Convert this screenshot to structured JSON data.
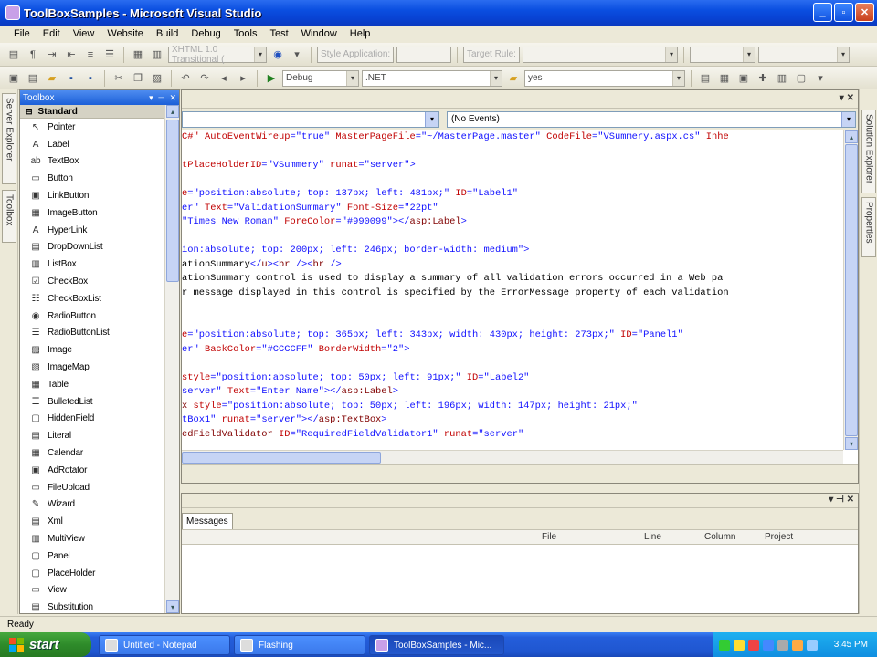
{
  "window": {
    "title": "ToolBoxSamples - Microsoft Visual Studio"
  },
  "menu": [
    "File",
    "Edit",
    "View",
    "Website",
    "Build",
    "Debug",
    "Tools",
    "Test",
    "Window",
    "Help"
  ],
  "toolbar1": {
    "doctype_combo": "XHTML 1.0 Transitional (",
    "style_application_label": "Style Application:",
    "target_rule_label": "Target Rule:"
  },
  "toolbar2": {
    "config_combo": "Debug",
    "platform_combo": ".NET",
    "find_combo": "yes"
  },
  "side_tabs": {
    "left": [
      "Server Explorer",
      "Toolbox"
    ],
    "right": [
      "Solution Explorer",
      "Properties"
    ]
  },
  "toolbox": {
    "title": "Toolbox",
    "group": "Standard",
    "items": [
      {
        "label": "Pointer",
        "icon": "pointer-icon",
        "glyph": "↖"
      },
      {
        "label": "Label",
        "icon": "label-icon",
        "glyph": "A"
      },
      {
        "label": "TextBox",
        "icon": "textbox-icon",
        "glyph": "ab"
      },
      {
        "label": "Button",
        "icon": "button-icon",
        "glyph": "▭"
      },
      {
        "label": "LinkButton",
        "icon": "linkbutton-icon",
        "glyph": "▣"
      },
      {
        "label": "ImageButton",
        "icon": "imagebutton-icon",
        "glyph": "▦"
      },
      {
        "label": "HyperLink",
        "icon": "hyperlink-icon",
        "glyph": "A"
      },
      {
        "label": "DropDownList",
        "icon": "dropdownlist-icon",
        "glyph": "▤"
      },
      {
        "label": "ListBox",
        "icon": "listbox-icon",
        "glyph": "▥"
      },
      {
        "label": "CheckBox",
        "icon": "checkbox-icon",
        "glyph": "☑"
      },
      {
        "label": "CheckBoxList",
        "icon": "checkboxlist-icon",
        "glyph": "☷"
      },
      {
        "label": "RadioButton",
        "icon": "radiobutton-icon",
        "glyph": "◉"
      },
      {
        "label": "RadioButtonList",
        "icon": "radiobuttonlist-icon",
        "glyph": "☰"
      },
      {
        "label": "Image",
        "icon": "image-icon",
        "glyph": "▨"
      },
      {
        "label": "ImageMap",
        "icon": "imagemap-icon",
        "glyph": "▧"
      },
      {
        "label": "Table",
        "icon": "table-icon",
        "glyph": "▦"
      },
      {
        "label": "BulletedList",
        "icon": "bulletedlist-icon",
        "glyph": "☰"
      },
      {
        "label": "HiddenField",
        "icon": "hiddenfield-icon",
        "glyph": "▢"
      },
      {
        "label": "Literal",
        "icon": "literal-icon",
        "glyph": "▤"
      },
      {
        "label": "Calendar",
        "icon": "calendar-icon",
        "glyph": "▦"
      },
      {
        "label": "AdRotator",
        "icon": "adrotator-icon",
        "glyph": "▣"
      },
      {
        "label": "FileUpload",
        "icon": "fileupload-icon",
        "glyph": "▭"
      },
      {
        "label": "Wizard",
        "icon": "wizard-icon",
        "glyph": "✎"
      },
      {
        "label": "Xml",
        "icon": "xml-icon",
        "glyph": "▤"
      },
      {
        "label": "MultiView",
        "icon": "multiview-icon",
        "glyph": "▥"
      },
      {
        "label": "Panel",
        "icon": "panel-icon",
        "glyph": "▢"
      },
      {
        "label": "PlaceHolder",
        "icon": "placeholder-icon",
        "glyph": "▢"
      },
      {
        "label": "View",
        "icon": "view-icon",
        "glyph": "▭"
      },
      {
        "label": "Substitution",
        "icon": "substitution-icon",
        "glyph": "▤"
      }
    ]
  },
  "editor": {
    "events_combo": "(No Events)",
    "code_lines": [
      [
        {
          "t": "C#\" ",
          "c": "red"
        },
        {
          "t": "AutoEventWireup",
          "c": "red"
        },
        {
          "t": "=",
          "c": "blue"
        },
        {
          "t": "\"true\" ",
          "c": "blue"
        },
        {
          "t": "MasterPageFile",
          "c": "red"
        },
        {
          "t": "=",
          "c": "blue"
        },
        {
          "t": "\"~/MasterPage.master\" ",
          "c": "blue"
        },
        {
          "t": "CodeFile",
          "c": "red"
        },
        {
          "t": "=",
          "c": "blue"
        },
        {
          "t": "\"VSummery.aspx.cs\" ",
          "c": "blue"
        },
        {
          "t": "Inhe",
          "c": "red"
        }
      ],
      [],
      [
        {
          "t": "tPlaceHolderID",
          "c": "red"
        },
        {
          "t": "=",
          "c": "blue"
        },
        {
          "t": "\"VSummery\" ",
          "c": "blue"
        },
        {
          "t": "runat",
          "c": "red"
        },
        {
          "t": "=",
          "c": "blue"
        },
        {
          "t": "\"server\">",
          "c": "blue"
        }
      ],
      [],
      [
        {
          "t": "e",
          "c": "red"
        },
        {
          "t": "=",
          "c": "blue"
        },
        {
          "t": "\"position:absolute; top: 137px; left: 481px;\" ",
          "c": "blue"
        },
        {
          "t": "ID",
          "c": "red"
        },
        {
          "t": "=",
          "c": "blue"
        },
        {
          "t": "\"Label1\"",
          "c": "blue"
        }
      ],
      [
        {
          "t": "er\" ",
          "c": "blue"
        },
        {
          "t": "Text",
          "c": "red"
        },
        {
          "t": "=",
          "c": "blue"
        },
        {
          "t": "\"ValidationSummary\" ",
          "c": "blue"
        },
        {
          "t": "Font-Size",
          "c": "red"
        },
        {
          "t": "=",
          "c": "blue"
        },
        {
          "t": "\"22pt\"",
          "c": "blue"
        }
      ],
      [
        {
          "t": "\"Times New Roman\" ",
          "c": "blue"
        },
        {
          "t": "ForeColor",
          "c": "red"
        },
        {
          "t": "=",
          "c": "blue"
        },
        {
          "t": "\"#990099\"",
          "c": "blue"
        },
        {
          "t": "></",
          "c": "blue"
        },
        {
          "t": "asp:Label",
          "c": "maroon"
        },
        {
          "t": ">",
          "c": "blue"
        }
      ],
      [],
      [
        {
          "t": "ion:absolute; top: 200px; left: 246px; border-width: medium\">",
          "c": "blue"
        }
      ],
      [
        {
          "t": "ationSummary",
          "c": "black"
        },
        {
          "t": "</",
          "c": "blue"
        },
        {
          "t": "u",
          "c": "maroon"
        },
        {
          "t": "><",
          "c": "blue"
        },
        {
          "t": "br",
          "c": "maroon"
        },
        {
          "t": " /><",
          "c": "blue"
        },
        {
          "t": "br",
          "c": "maroon"
        },
        {
          "t": " />",
          "c": "blue"
        }
      ],
      [
        {
          "t": "ationSummary control is used to display a summary of all validation errors occurred in a Web pa",
          "c": "black"
        }
      ],
      [
        {
          "t": "r message displayed in this control is specified by the ErrorMessage property of each validation",
          "c": "black"
        }
      ],
      [],
      [],
      [
        {
          "t": "e",
          "c": "red"
        },
        {
          "t": "=",
          "c": "blue"
        },
        {
          "t": "\"position:absolute; top: 365px; left: 343px; width: 430px; height: 273px;\" ",
          "c": "blue"
        },
        {
          "t": "ID",
          "c": "red"
        },
        {
          "t": "=",
          "c": "blue"
        },
        {
          "t": "\"Panel1\"",
          "c": "blue"
        }
      ],
      [
        {
          "t": "er\" ",
          "c": "blue"
        },
        {
          "t": "BackColor",
          "c": "red"
        },
        {
          "t": "=",
          "c": "blue"
        },
        {
          "t": "\"#CCCCFF\" ",
          "c": "blue"
        },
        {
          "t": "BorderWidth",
          "c": "red"
        },
        {
          "t": "=",
          "c": "blue"
        },
        {
          "t": "\"2\">",
          "c": "blue"
        }
      ],
      [],
      [
        {
          "t": "style",
          "c": "red"
        },
        {
          "t": "=",
          "c": "blue"
        },
        {
          "t": "\"position:absolute; top: 50px; left: 91px;\" ",
          "c": "blue"
        },
        {
          "t": "ID",
          "c": "red"
        },
        {
          "t": "=",
          "c": "blue"
        },
        {
          "t": "\"Label2\"",
          "c": "blue"
        }
      ],
      [
        {
          "t": "server\" ",
          "c": "blue"
        },
        {
          "t": "Text",
          "c": "red"
        },
        {
          "t": "=",
          "c": "blue"
        },
        {
          "t": "\"Enter Name\"",
          "c": "blue"
        },
        {
          "t": "></",
          "c": "blue"
        },
        {
          "t": "asp:Label",
          "c": "maroon"
        },
        {
          "t": ">",
          "c": "blue"
        }
      ],
      [
        {
          "t": "x ",
          "c": "maroon"
        },
        {
          "t": "style",
          "c": "red"
        },
        {
          "t": "=",
          "c": "blue"
        },
        {
          "t": "\"position:absolute; top: 50px; left: 196px; width: 147px; height: 21px;\"",
          "c": "blue"
        }
      ],
      [
        {
          "t": "tBox1\" ",
          "c": "blue"
        },
        {
          "t": "runat",
          "c": "red"
        },
        {
          "t": "=",
          "c": "blue"
        },
        {
          "t": "\"server\"",
          "c": "blue"
        },
        {
          "t": "></",
          "c": "blue"
        },
        {
          "t": "asp:TextBox",
          "c": "maroon"
        },
        {
          "t": ">",
          "c": "blue"
        }
      ],
      [
        {
          "t": "edFieldValidator ",
          "c": "maroon"
        },
        {
          "t": "ID",
          "c": "red"
        },
        {
          "t": "=",
          "c": "blue"
        },
        {
          "t": "\"RequiredFieldValidator1\" ",
          "c": "blue"
        },
        {
          "t": "runat",
          "c": "red"
        },
        {
          "t": "=",
          "c": "blue"
        },
        {
          "t": "\"server\"",
          "c": "blue"
        }
      ]
    ]
  },
  "error_list": {
    "tab": "Messages",
    "columns": [
      "File",
      "Line",
      "Column",
      "Project"
    ]
  },
  "status": {
    "text": "Ready"
  },
  "taskbar": {
    "start_label": "start",
    "tasks": [
      "Untitled - Notepad",
      "Flashing",
      "ToolBoxSamples - Mic..."
    ],
    "clock": "3:45 PM"
  }
}
